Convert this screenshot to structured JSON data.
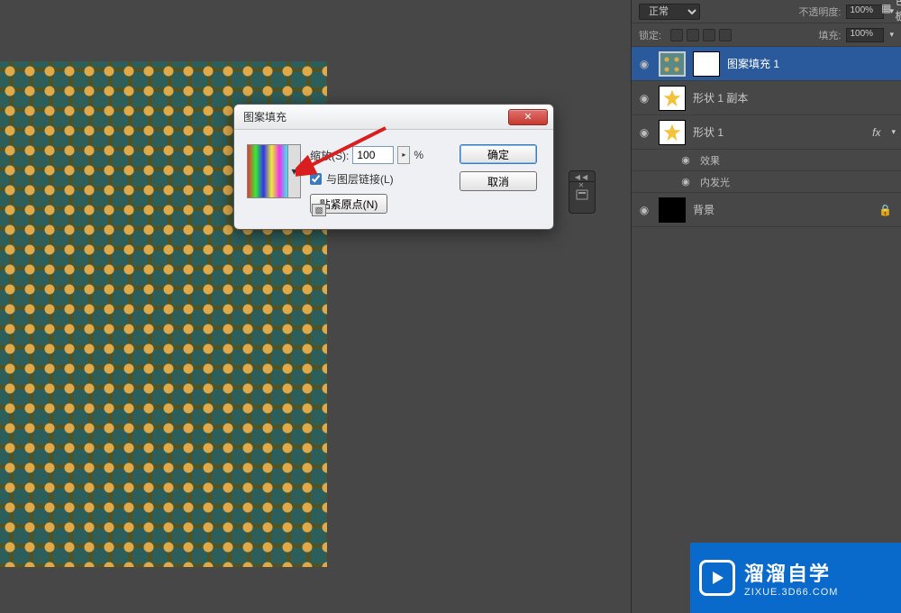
{
  "dialog": {
    "title": "图案填充",
    "scale_label": "缩放(S):",
    "scale_value": "100",
    "scale_unit": "%",
    "link_label": "与图层链接(L)",
    "link_checked": true,
    "snap_button": "贴紧原点(N)",
    "ok": "确定",
    "cancel": "取消",
    "close_glyph": "✕"
  },
  "panel": {
    "blend_mode": "正常",
    "opacity_label": "不透明度:",
    "opacity_value": "100%",
    "lock_label": "锁定:",
    "fill_label": "填充:",
    "fill_value": "100%",
    "side_tab": "色板"
  },
  "layers": [
    {
      "name": "图案填充 1",
      "thumb": "patternfill",
      "mask": true,
      "selected": true,
      "visible": true
    },
    {
      "name": "形状 1 副本",
      "thumb": "star",
      "visible": true
    },
    {
      "name": "形状 1",
      "thumb": "star",
      "visible": true,
      "fx": true,
      "effects_label": "效果",
      "effects": [
        "内发光"
      ]
    },
    {
      "name": "背景",
      "thumb": "bg",
      "visible": true,
      "locked": true
    }
  ],
  "dock": {
    "collapse": "◀◀ ✕"
  },
  "watermark": {
    "big": "溜溜自学",
    "small": "ZIXUE.3D66.COM"
  },
  "icons": {
    "eye": "◉",
    "chev": "▾",
    "tri": "▾",
    "lock": "🔒",
    "play": "▷",
    "spin": "▸",
    "grid": "▦"
  }
}
